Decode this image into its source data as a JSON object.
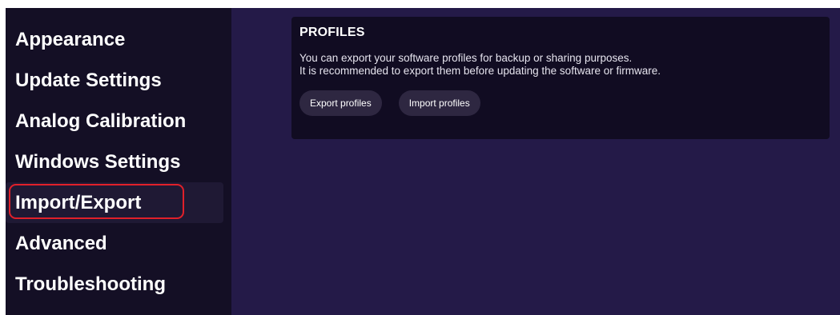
{
  "sidebar": {
    "items": [
      {
        "label": "Appearance"
      },
      {
        "label": "Update Settings"
      },
      {
        "label": "Analog Calibration"
      },
      {
        "label": "Windows Settings"
      },
      {
        "label": "Import/Export"
      },
      {
        "label": "Advanced"
      },
      {
        "label": "Troubleshooting"
      }
    ],
    "active_index": 4
  },
  "profiles": {
    "title": "PROFILES",
    "description_line1": "You can export your software profiles for backup or sharing purposes.",
    "description_line2": "It is recommended to export them before updating the software or firmware.",
    "export_label": "Export profiles",
    "import_label": "Import profiles"
  },
  "colors": {
    "sidebar_bg": "#140f25",
    "main_bg": "#241a48",
    "card_bg": "#110c22",
    "button_bg": "#2e2741",
    "highlight": "#e0202a"
  }
}
